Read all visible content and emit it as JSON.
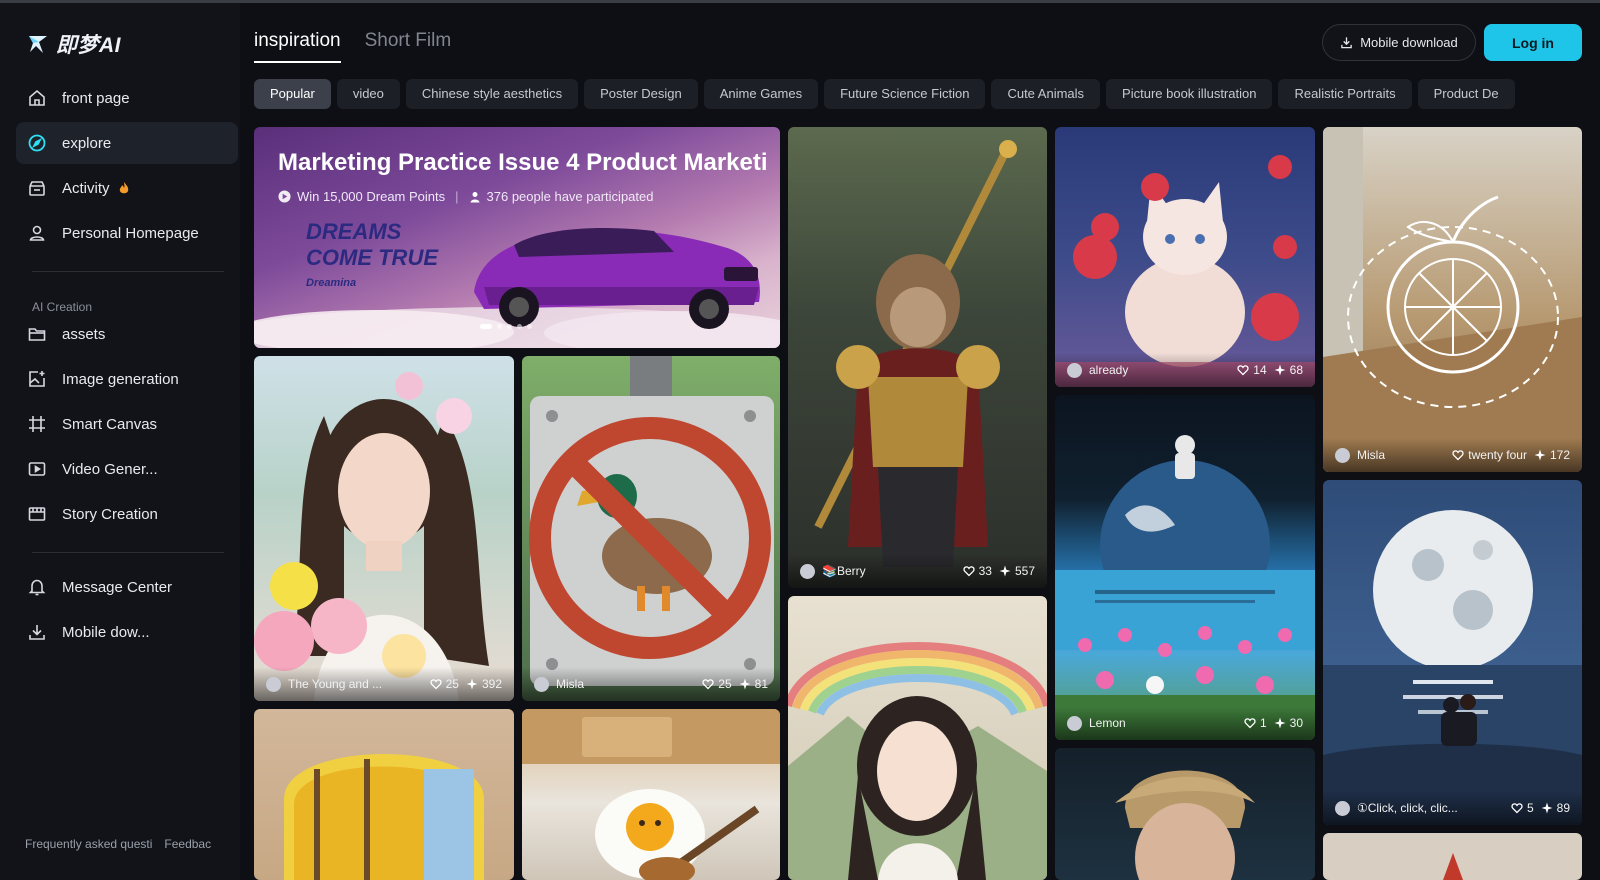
{
  "app": {
    "logo_text": "即梦AI"
  },
  "sidebar": {
    "nav": [
      {
        "label": "front page",
        "icon": "home-icon"
      },
      {
        "label": "explore",
        "icon": "compass-icon"
      },
      {
        "label": "Activity",
        "icon": "gift-icon"
      },
      {
        "label": "Personal Homepage",
        "icon": "user-icon"
      }
    ],
    "section_title": "AI Creation",
    "creation": [
      {
        "label": "assets",
        "icon": "folder-icon"
      },
      {
        "label": "Image generation",
        "icon": "image-gen-icon"
      },
      {
        "label": "Smart Canvas",
        "icon": "canvas-icon"
      },
      {
        "label": "Video Gener...",
        "icon": "video-icon"
      },
      {
        "label": "Story Creation",
        "icon": "story-icon"
      }
    ],
    "bottom": [
      {
        "label": "Message Center",
        "icon": "bell-icon"
      },
      {
        "label": "Mobile dow...",
        "icon": "download-icon"
      }
    ],
    "footer": {
      "faq": "Frequently asked questi",
      "feedback": "Feedbac"
    }
  },
  "header": {
    "tabs": [
      "inspiration",
      "Short Film"
    ],
    "download_label": "Mobile download",
    "login_label": "Log in"
  },
  "categories": [
    "Popular",
    "video",
    "Chinese style aesthetics",
    "Poster Design",
    "Anime Games",
    "Future Science Fiction",
    "Cute Animals",
    "Picture book illustration",
    "Realistic Portraits",
    "Product De"
  ],
  "banner": {
    "title": "Marketing Practice Issue 4 Product Marketi",
    "reward": "Win 15,000 Dream Points",
    "participants": "376 people have participated",
    "slogan_line1": "DREAMS",
    "slogan_line2": "COME TRUE",
    "brand": "Dreamina"
  },
  "cards": {
    "girl_flowers": {
      "author": "The Young and ...",
      "likes": "25",
      "remixes": "392"
    },
    "duck_sign": {
      "author": "Misla",
      "likes": "25",
      "remixes": "81"
    },
    "monkey_king": {
      "author": "📚Berry",
      "likes": "33",
      "remixes": "557"
    },
    "cat_roses": {
      "author": "already",
      "likes": "14",
      "remixes": "68"
    },
    "astronaut": {
      "author": "Lemon",
      "likes": "1",
      "remixes": "30"
    },
    "orange_sketch": {
      "author": "Misla",
      "likes": "twenty four",
      "remixes": "172"
    },
    "moon_couple": {
      "author": "①Click, click, clic...",
      "likes": "5",
      "remixes": "89"
    }
  }
}
